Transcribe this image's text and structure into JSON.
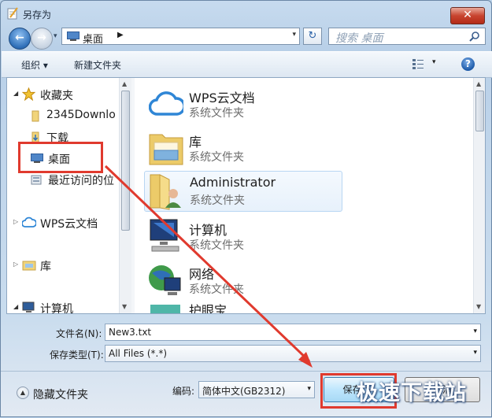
{
  "window": {
    "title": "另存为",
    "close_label": "✕"
  },
  "nav": {
    "back": "←",
    "forward": "→",
    "history": "▾",
    "address": {
      "location": "桌面",
      "separator": "▶",
      "dropdown": "▾"
    },
    "refresh": "↻",
    "search_placeholder": "搜索 桌面"
  },
  "toolbar": {
    "organize": "组织 ▾",
    "new_folder": "新建文件夹",
    "view_drop": "▾",
    "help": "?"
  },
  "sidebar": {
    "groups": [
      {
        "label": "收藏夹",
        "expander": "◢"
      },
      {
        "label": "WPS云文档",
        "expander": "▷"
      },
      {
        "label": "库",
        "expander": "▷"
      },
      {
        "label": "计算机",
        "expander": "◢"
      }
    ],
    "favorites": [
      "2345Downlo",
      "下载",
      "桌面",
      "最近访问的位"
    ],
    "scroll_up": "▲",
    "scroll_down": "▼"
  },
  "content": {
    "items": [
      {
        "name": "WPS云文档",
        "type": "系统文件夹"
      },
      {
        "name": "库",
        "type": "系统文件夹"
      },
      {
        "name": "Administrator",
        "type": "系统文件夹"
      },
      {
        "name": "计算机",
        "type": "系统文件夹"
      },
      {
        "name": "网络",
        "type": "系统文件夹"
      },
      {
        "name": "护眼宝",
        "type": ""
      }
    ]
  },
  "form": {
    "filename_label": "文件名(N):",
    "filename_value": "New3.txt",
    "filetype_label": "保存类型(T):",
    "filetype_value": "All Files (*.*)",
    "dropdown": "▾"
  },
  "footer": {
    "hide_folders": "隐藏文件夹",
    "hide_icon": "▲",
    "encoding_label": "编码:",
    "encoding_value": "简体中文(GB2312)",
    "save": "保存(S)",
    "cancel": "取消"
  },
  "watermark": "极速下载站",
  "colors": {
    "highlight": "#e03a2e",
    "accent": "#2f6fb8"
  }
}
